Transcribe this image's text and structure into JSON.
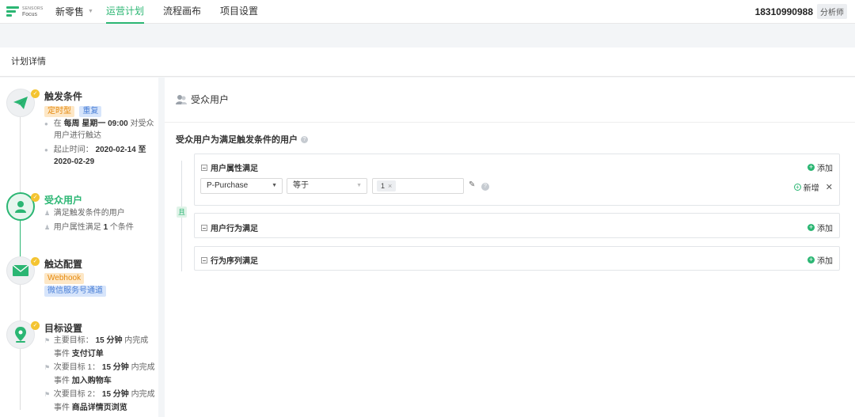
{
  "topbar": {
    "logo_line1": "SENSORS",
    "logo_line2": "Focus",
    "project": "新零售",
    "nav": [
      "运营计划",
      "流程画布",
      "项目设置"
    ],
    "active_nav": "运营计划",
    "phone": "18310990988",
    "role": "分析师"
  },
  "header": {
    "title": "计划详情"
  },
  "steps": {
    "trigger": {
      "title": "触发条件",
      "tags": [
        "定时型",
        "重复"
      ],
      "line1_prefix": "在",
      "line1_bold": "每周 星期一 09:00",
      "line1_suffix": "对受众",
      "line2": "用户进行触达",
      "time_label": "起止时间：",
      "time_start": "2020-02-14 至",
      "time_end": "2020-02-29"
    },
    "audience": {
      "title": "受众用户",
      "desc1": "满足触发条件的用户",
      "desc2_prefix": "用户属性满足",
      "desc2_bold": "1",
      "desc2_suffix": "个条件"
    },
    "channel": {
      "title": "触达配置",
      "tags": [
        "Webhook",
        "微信服务号通道"
      ]
    },
    "goal": {
      "title": "目标设置",
      "g1_label": "主要目标：",
      "g1_time": "15 分钟",
      "g1_suffix": "内完成",
      "g1_event_prefix": "事件",
      "g1_event": "支付订单",
      "g2_label": "次要目标 1：",
      "g2_time": "15 分钟",
      "g2_suffix": "内完成",
      "g2_event_prefix": "事件",
      "g2_event": "加入购物车",
      "g3_label": "次要目标 2：",
      "g3_time": "15 分钟",
      "g3_suffix": "内完成",
      "g3_event_prefix": "事件",
      "g3_event": "商品详情页浏览"
    }
  },
  "main": {
    "section_title": "受众用户",
    "audience_title": "受众用户为满足触发条件的用户",
    "and_label": "且",
    "groups": {
      "user_attr": "用户属性满足",
      "user_behavior": "用户行为满足",
      "behavior_seq": "行为序列满足"
    },
    "add_label": "添加",
    "rule": {
      "property": "P-Purchase",
      "operator": "等于",
      "value_chip": "1",
      "new_label": "新增"
    }
  },
  "colors": {
    "accent": "#2bb673",
    "badge_check": "#f4c431",
    "tag_orange": "#e58a0f",
    "tag_blue": "#4a7fd6"
  }
}
